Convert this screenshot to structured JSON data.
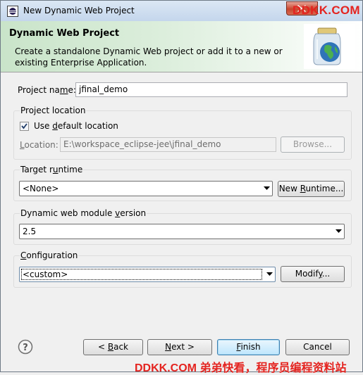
{
  "window": {
    "title": "New Dynamic Web Project",
    "watermark_top": "DDKK.COM",
    "watermark_bottom": "DDKK.COM 弟弟快看，程序员编程资料站"
  },
  "banner": {
    "title": "Dynamic Web Project",
    "description": "Create a standalone Dynamic Web project or add it to a new or existing Enterprise Application.",
    "graphic_icon": "jar-globe-icon"
  },
  "project_name": {
    "label_pre": "Project na",
    "label_mnemonic": "m",
    "label_post": "e:",
    "value": "jfinal_demo"
  },
  "project_location": {
    "group_title": "Project location",
    "use_default_pre": "Use ",
    "use_default_mnemonic": "d",
    "use_default_post": "efault location",
    "use_default_checked": true,
    "location_pre": "",
    "location_mnemonic": "L",
    "location_post": "ocation:",
    "location_value": "E:\\workspace_eclipse-jee\\jfinal_demo",
    "browse_label": "Browse..."
  },
  "target_runtime": {
    "group_title_pre": "Target r",
    "group_title_mnemonic": "u",
    "group_title_post": "ntime",
    "selected": "<None>",
    "new_runtime_pre": "New ",
    "new_runtime_mnemonic": "R",
    "new_runtime_post": "untime..."
  },
  "module_version": {
    "group_title_pre": "Dynamic web module ",
    "group_title_mnemonic": "v",
    "group_title_post": "ersion",
    "selected": "2.5"
  },
  "configuration": {
    "group_title_pre": "",
    "group_title_mnemonic": "C",
    "group_title_post": "onfiguration",
    "selected": "<custom>",
    "modify_pre": "Modif",
    "modify_mnemonic": "y",
    "modify_post": "..."
  },
  "footer": {
    "help_icon": "help-question-icon",
    "back_pre": "< ",
    "back_mnemonic": "B",
    "back_post": "ack",
    "next_mnemonic": "N",
    "next_post": "ext >",
    "finish_mnemonic": "F",
    "finish_post": "inish",
    "cancel_label": "Cancel"
  },
  "colors": {
    "banner_green": "#c9e4c9",
    "title_bar": "#c4d6ec",
    "close_red": "#c8452c",
    "watermark_red": "#e4231f",
    "default_button": "#bee6fd"
  }
}
